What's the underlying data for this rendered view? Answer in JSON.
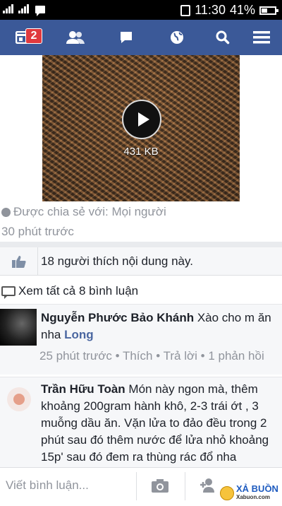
{
  "status_bar": {
    "time": "11:30",
    "battery": "41%",
    "icons": [
      "signal-icon",
      "message-icon",
      "phone-icon",
      "battery-icon"
    ]
  },
  "nav": {
    "notifications_badge": "2",
    "icons": [
      "news-feed-icon",
      "friends-icon",
      "messages-icon",
      "globe-icon",
      "search-icon",
      "menu-icon"
    ]
  },
  "post": {
    "video_size": "431 KB",
    "shared_with": "Được chia sẻ với: Mọi người",
    "time": "30 phút trước"
  },
  "likes": {
    "text": "18 người thích nội dung này."
  },
  "comments_link": "Xem tất cả 8 bình luận",
  "comments": [
    {
      "author": "Nguyễn Phước Bảo Khánh",
      "text_before": "Xào cho m ăn nha",
      "mention": "Long",
      "time": "25 phút trước",
      "like": "Thích",
      "reply": "Trả lời",
      "replies": "1 phản hồi"
    },
    {
      "author": "Trần Hữu Toàn",
      "text": "Món này ngon mà, thêm khoảng 200gram hành khô, 2-3 trái ớt , 3 muỗng dầu ăn. Vặn lửa to đảo đều trong 2 phút sau đó thêm nước để lửa nhỏ khoảng 15p' sau đó đem ra thùng rác đổ nha"
    }
  ],
  "composer": {
    "placeholder": "Viết bình luận..."
  },
  "watermark": {
    "text": "XẢ BUỒN",
    "sub": "Xabuon.com"
  },
  "colors": {
    "nav_bg": "#3b5998",
    "badge": "#e0393e",
    "mention": "#4b67a1"
  }
}
